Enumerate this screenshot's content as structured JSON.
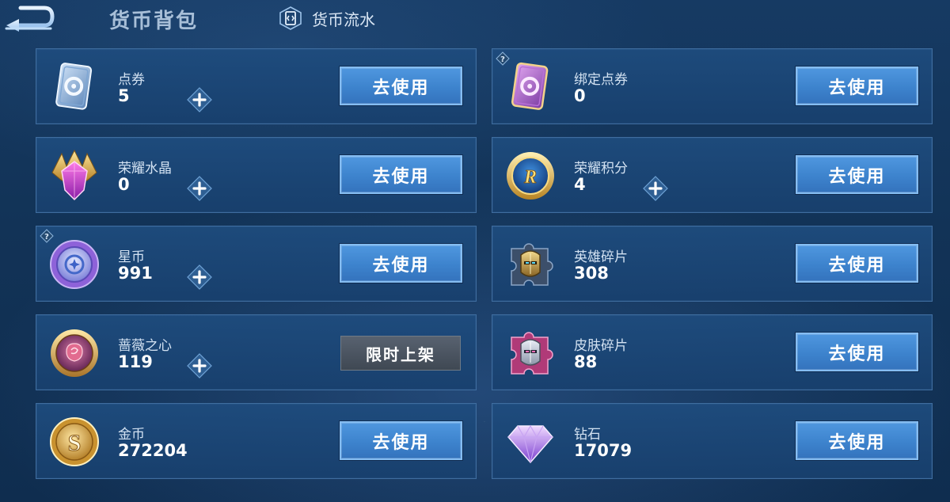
{
  "header": {
    "title": "货币背包",
    "history_label": "货币流水"
  },
  "currencies": [
    {
      "name": "点券",
      "value": "5",
      "action": "去使用"
    },
    {
      "name": "绑定点券",
      "value": "0",
      "action": "去使用"
    },
    {
      "name": "荣耀水晶",
      "value": "0",
      "action": "去使用"
    },
    {
      "name": "荣耀积分",
      "value": "4",
      "action": "去使用"
    },
    {
      "name": "星币",
      "value": "991",
      "action": "去使用"
    },
    {
      "name": "英雄碎片",
      "value": "308",
      "action": "去使用"
    },
    {
      "name": "蔷薇之心",
      "value": "119",
      "action": "限时上架"
    },
    {
      "name": "皮肤碎片",
      "value": "88",
      "action": "去使用"
    },
    {
      "name": "金币",
      "value": "272204",
      "action": "去使用"
    },
    {
      "name": "钻石",
      "value": "17079",
      "action": "去使用"
    }
  ],
  "icons": {
    "back": "back-arrow-icon",
    "history": "ledger-icon",
    "plus": "plus-icon",
    "help": "question-icon"
  },
  "colors": {
    "button_blue": "#4a90d9",
    "card_bg": "#1e4c7e",
    "badge_gray": "#4a535e"
  }
}
